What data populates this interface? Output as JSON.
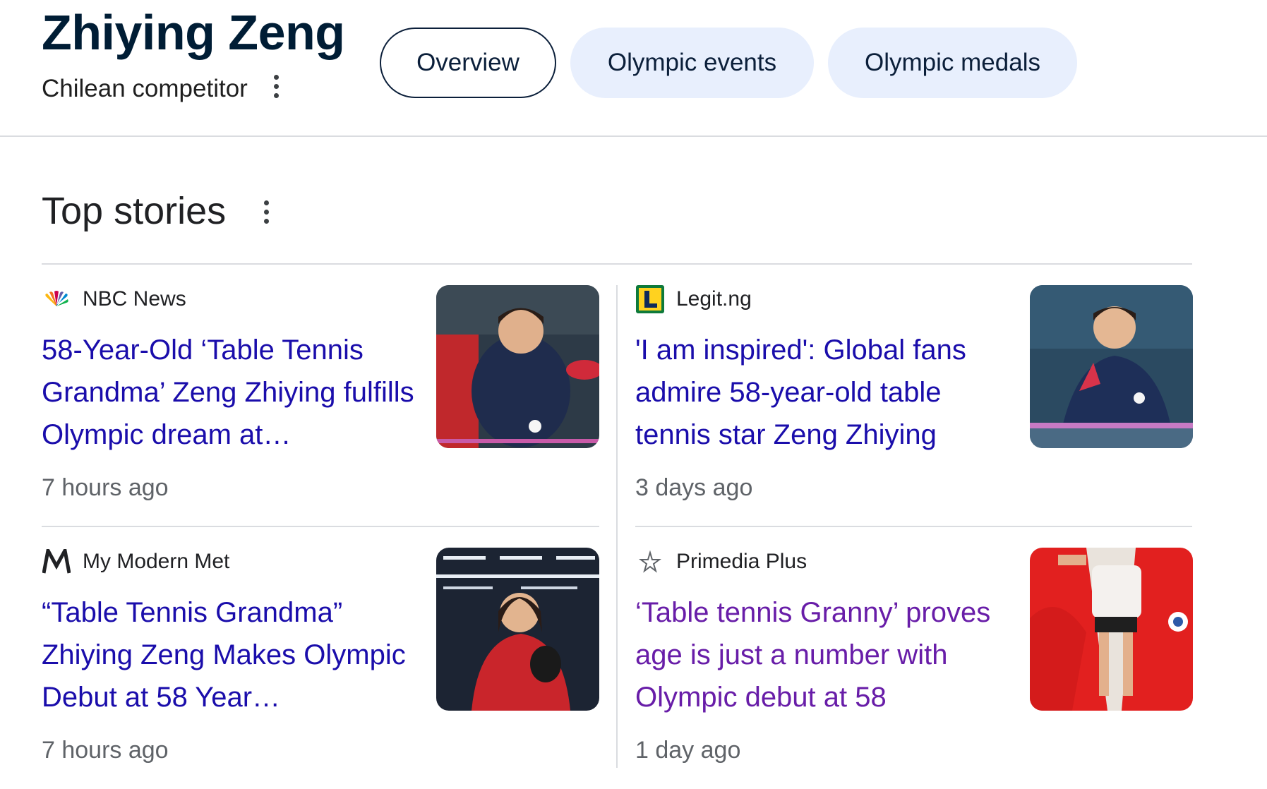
{
  "entity": {
    "title": "Zhiying Zeng",
    "subtitle": "Chilean competitor"
  },
  "tabs": [
    {
      "label": "Overview",
      "active": true
    },
    {
      "label": "Olympic events",
      "active": false
    },
    {
      "label": "Olympic medals",
      "active": false
    }
  ],
  "top_stories": {
    "title": "Top stories",
    "items": [
      {
        "source": "NBC News",
        "logo_icon": "nbc-peacock-icon",
        "headline": "58-Year-Old ‘Table Tennis Grandma’ Zeng Zhiying fulfills Olympic dream at…",
        "time": "7 hours ago",
        "thumbnail": "table-tennis-player-image"
      },
      {
        "source": "Legit.ng",
        "logo_icon": "legit-ng-logo-icon",
        "headline": "'I am inspired': Global fans admire 58-year-old table tennis star Zeng Zhiying",
        "time": "3 days ago",
        "thumbnail": "table-tennis-player-image"
      },
      {
        "source": "My Modern Met",
        "logo_icon": "my-modern-met-logo-icon",
        "headline": "“Table Tennis Grandma” Zhiying Zeng Makes Olympic Debut at 58 Year…",
        "time": "7 hours ago",
        "thumbnail": "table-tennis-player-image"
      },
      {
        "source": "Primedia Plus",
        "logo_icon": "primedia-plus-logo-icon",
        "headline": "‘Table tennis Granny’ proves age is just a number with Olympic debut at 58",
        "time": "1 day ago",
        "thumbnail": "table-tennis-player-image",
        "visited": true
      }
    ]
  },
  "colors": {
    "link": "#1a0dab",
    "visited_link": "#681da8",
    "title": "#001d35",
    "tab_bg": "#e8effd",
    "divider": "#dadce0"
  }
}
